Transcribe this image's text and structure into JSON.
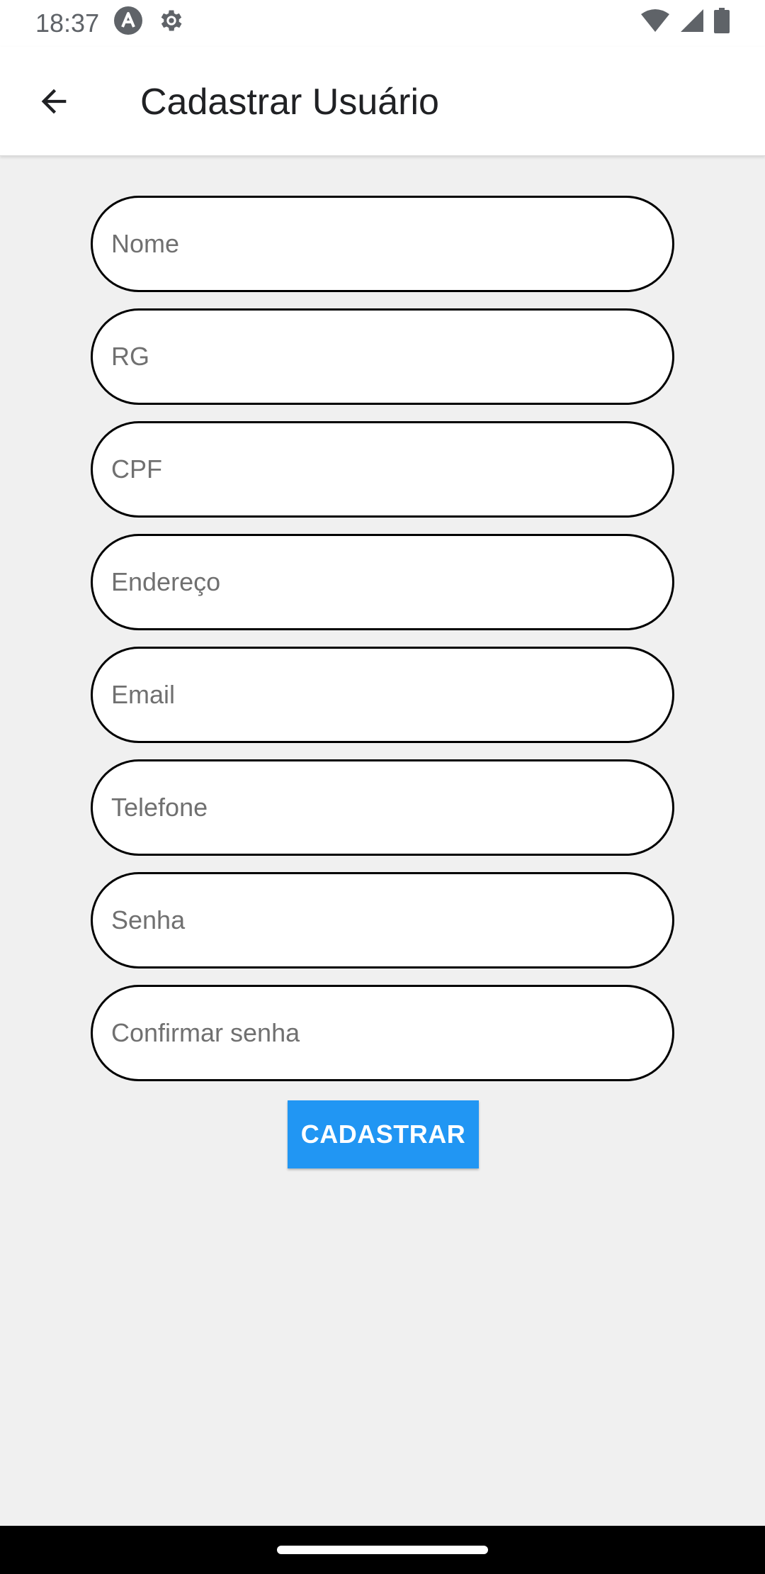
{
  "status_bar": {
    "time": "18:37",
    "left_icons": [
      "android-a-icon",
      "gear-icon"
    ],
    "right_icons": [
      "wifi-icon",
      "signal-icon",
      "battery-icon"
    ]
  },
  "app_bar": {
    "title": "Cadastrar Usuário",
    "back_icon": "arrow-back-icon"
  },
  "form": {
    "fields": [
      {
        "name": "nome",
        "placeholder": "Nome",
        "value": ""
      },
      {
        "name": "rg",
        "placeholder": "RG",
        "value": ""
      },
      {
        "name": "cpf",
        "placeholder": "CPF",
        "value": ""
      },
      {
        "name": "endereco",
        "placeholder": "Endereço",
        "value": ""
      },
      {
        "name": "email",
        "placeholder": "Email",
        "value": ""
      },
      {
        "name": "telefone",
        "placeholder": "Telefone",
        "value": ""
      },
      {
        "name": "senha",
        "placeholder": "Senha",
        "value": ""
      },
      {
        "name": "confirmar-senha",
        "placeholder": "Confirmar senha",
        "value": ""
      }
    ],
    "submit_label": "CADASTRAR"
  },
  "colors": {
    "accent": "#2196f3",
    "background": "#f0f0f0",
    "app_bar": "#ffffff"
  }
}
